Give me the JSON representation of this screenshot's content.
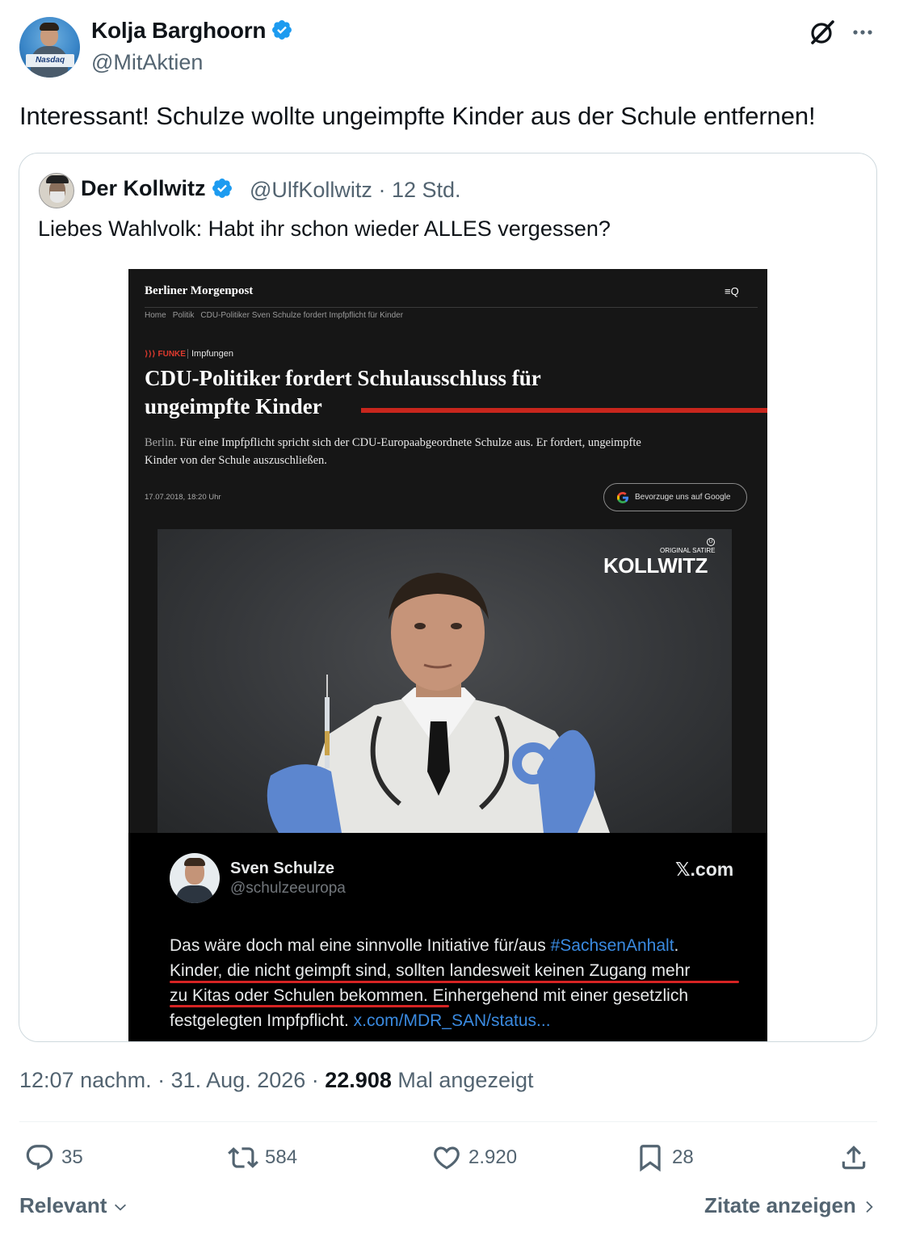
{
  "author": {
    "name": "Kolja Barghoorn",
    "handle": "@MitAktien",
    "avatar_sign": "Nasdaq"
  },
  "tweet_text": "Interessant! Schulze wollte ungeimpfte Kinder aus der Schule entfernen!",
  "quote": {
    "name": "Der Kollwitz",
    "handle": "@UlfKollwitz",
    "time": "12 Std.",
    "text": "Liebes Wahlvolk: Habt ihr schon wieder ALLES vergessen?",
    "image": {
      "logo": "Berliner Morgenpost",
      "menu_icon": "≡Q",
      "breadcrumb": [
        "Home",
        "Politik",
        "CDU-Politiker Sven Schulze fordert Impfpflicht für Kinder"
      ],
      "funke": "FUNKE",
      "category": "Impfungen",
      "headline_line1": "CDU-Politiker fordert Schulausschluss für",
      "headline_line2": "ungeimpfte Kinder",
      "lead_city": "Berlin.",
      "lead_text": "Für eine Impfpflicht spricht sich der CDU-Europaabgeordnete Schulze aus. Er fordert, ungeimpfte Kinder von der Schule auszuschließen.",
      "date": "17.07.2018, 18:20 Uhr",
      "google_button": "Bevorzuge uns auf Google",
      "watermark_small": "ORIGINAL SATIRE",
      "watermark": "KOLLWITZ",
      "watermark_mark": "U",
      "embedded_post": {
        "name": "Sven Schulze",
        "handle": "@schulzeeuropa",
        "site": "𝕏.com",
        "line1_a": "Das wäre doch mal eine sinnvolle Initiative für/aus ",
        "line1_tag": "#SachsenAnhalt",
        "line1_b": ".",
        "line2": "Kinder, die nicht geimpft sind, sollten landesweit keinen Zugang mehr",
        "line3_a": "zu Kitas oder Schulen bekommen.",
        "line3_b": " Einhergehend mit einer gesetzlich",
        "line4_a": "festgelegten Impfpflicht. ",
        "line4_link": "x.com/MDR_SAN/status..."
      }
    }
  },
  "meta": {
    "time": "12:07 nachm.",
    "date": "31. Aug. 2026",
    "views": "22.908",
    "views_label": "Mal angezeigt"
  },
  "actions": {
    "replies": "35",
    "reposts": "584",
    "likes": "2.920",
    "bookmarks": "28"
  },
  "footer": {
    "sort_label": "Relevant",
    "quotes_link": "Zitate anzeigen"
  },
  "colors": {
    "verified": "#1d9bf0",
    "muted": "#536471",
    "accent_red": "#c8261d"
  }
}
